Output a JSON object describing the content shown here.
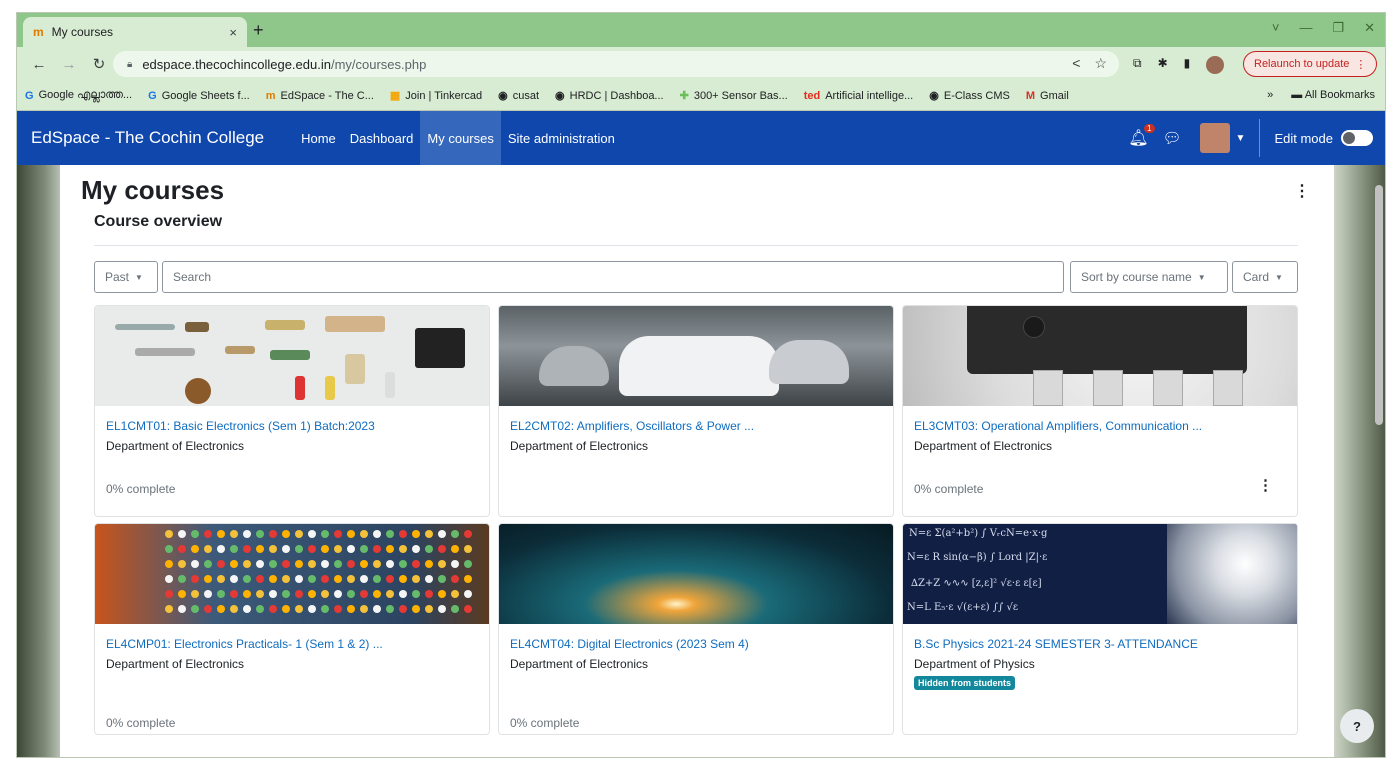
{
  "browser": {
    "tab_title": "My courses",
    "tab_close": "×",
    "new_tab": "+",
    "url_host": "edspace.thecochincollege.edu.in",
    "url_path": "/my/courses.php",
    "relaunch_label": "Relaunch to update",
    "window_controls": [
      "˅",
      "—",
      "❐",
      "✕"
    ],
    "bookmarks": [
      {
        "label": "Google എല്ലാത്ത...",
        "icon": "G",
        "color": "#1a73e8"
      },
      {
        "label": "Google Sheets f...",
        "icon": "G",
        "color": "#1a73e8"
      },
      {
        "label": "EdSpace - The C...",
        "icon": "m",
        "color": "#e07b00"
      },
      {
        "label": "Join | Tinkercad",
        "icon": "▦",
        "color": "#f4a300"
      },
      {
        "label": "cusat",
        "icon": "◉",
        "color": "#202124"
      },
      {
        "label": "HRDC | Dashboa...",
        "icon": "◉",
        "color": "#202124"
      },
      {
        "label": "300+ Sensor Bas...",
        "icon": "✚",
        "color": "#6bbf59"
      },
      {
        "label": "Artificial intellige...",
        "icon": "ted",
        "color": "#e62b1e"
      },
      {
        "label": "E-Class CMS",
        "icon": "◉",
        "color": "#202124"
      },
      {
        "label": "Gmail",
        "icon": "M",
        "color": "#d93025"
      }
    ],
    "bookmarks_more": "»",
    "all_bookmarks": "All Bookmarks"
  },
  "navbar": {
    "brand": "EdSpace - The Cochin College",
    "links": [
      "Home",
      "Dashboard",
      "My courses",
      "Site administration"
    ],
    "active_link": "My courses",
    "notification_count": "1",
    "edit_mode_label": "Edit mode"
  },
  "page": {
    "title": "My courses",
    "section_title": "Course overview",
    "filter_label": "Past",
    "search_placeholder": "Search",
    "sort_label": "Sort by course name",
    "view_label": "Card",
    "help_label": "?"
  },
  "courses": [
    {
      "name": "EL1CMT01: Basic Electronics (Sem 1) Batch:2023",
      "category": "Department of Electronics",
      "progress": "0% complete"
    },
    {
      "name": "EL2CMT02: Amplifiers, Oscillators & Power ...",
      "category": "Department of Electronics",
      "progress": ""
    },
    {
      "name": "EL3CMT03: Operational Amplifiers, Communication ...",
      "category": "Department of Electronics",
      "progress": "0% complete"
    },
    {
      "name": "EL4CMP01: Electronics Practicals- 1 (Sem 1 & 2) ...",
      "category": "Department of Electronics",
      "progress": "0% complete"
    },
    {
      "name": "EL4CMT04: Digital Electronics (2023 Sem 4)",
      "category": "Department of Electronics",
      "progress": "0% complete"
    },
    {
      "name": "B.Sc Physics 2021-24 SEMESTER 3- ATTENDANCE",
      "category": "Department of Physics",
      "progress": "",
      "badge": "Hidden from students"
    }
  ]
}
